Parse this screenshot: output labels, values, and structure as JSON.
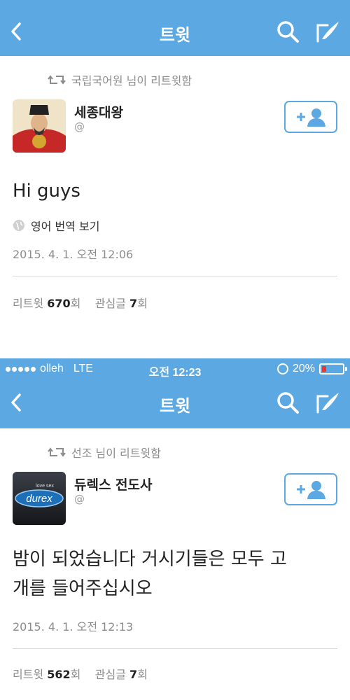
{
  "colors": {
    "accent": "#5ba8e2",
    "battery_low": "#e8392f"
  },
  "top": {
    "nav": {
      "title": "트윗",
      "back_icon": "chevron-left-icon",
      "search_icon": "search-icon",
      "compose_icon": "compose-icon"
    },
    "retweet_by": "국립국어원 님이 리트윗함",
    "author": {
      "name": "세종대왕",
      "handle": "@"
    },
    "text": "Hi guys",
    "translate": "영어 번역 보기",
    "timestamp": "2015. 4. 1. 오전 12:06",
    "stats": {
      "retweet_label": "리트윗",
      "retweet_count": "670",
      "retweet_suffix": "회",
      "fav_label": "관심글",
      "fav_count": "7",
      "fav_suffix": "회"
    }
  },
  "bottom": {
    "status": {
      "carrier": "olleh",
      "network": "LTE",
      "time": "오전 12:23",
      "battery": "20%",
      "battery_level": 0.2
    },
    "nav": {
      "title": "트윗",
      "back_icon": "chevron-left-icon",
      "search_icon": "search-icon",
      "compose_icon": "compose-icon"
    },
    "retweet_by": "선조 님이 리트윗함",
    "author": {
      "name": "듀렉스 전도사",
      "handle": "@",
      "avatar_logo": "durex",
      "avatar_tagline": "love sex"
    },
    "text_line1": "밤이 되었습니다 거시기들은 모두 고",
    "text_line2": "개를 들어주십시오",
    "timestamp": "2015. 4. 1. 오전 12:13",
    "stats": {
      "retweet_label": "리트윗",
      "retweet_count": "562",
      "retweet_suffix": "회",
      "fav_label": "관심글",
      "fav_count": "7",
      "fav_suffix": "회"
    }
  }
}
